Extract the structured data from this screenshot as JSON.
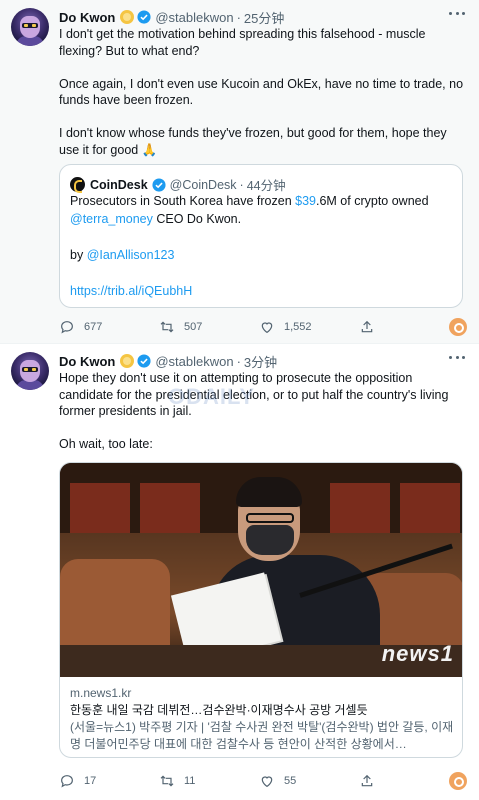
{
  "tweets": [
    {
      "author": "Do Kwon",
      "handle": "@stablekwon",
      "time": "25分钟",
      "text": "I don't get the motivation behind spreading this falsehood - muscle flexing? But to what end?\n\nOnce again, I don't even use Kucoin and OkEx, have no time to trade, no funds have been frozen.\n\nI don't know whose funds they've frozen, but good for them, hope they use it for good 🙏",
      "quote": {
        "author": "CoinDesk",
        "handle": "@CoinDesk",
        "time": "44分钟",
        "line1_pre": "Prosecutors in South Korea have frozen ",
        "line1_link": "$39",
        "line1_post": ".6M of crypto owned",
        "line2_link": "@terra_money",
        "line2_post": " CEO Do Kwon.",
        "by_pre": "by ",
        "by_link": "@IanAllison123",
        "url": "https://trib.al/iQEubhH"
      },
      "stats": {
        "replies": "677",
        "retweets": "507",
        "likes": "1,552"
      }
    },
    {
      "author": "Do Kwon",
      "handle": "@stablekwon",
      "time": "3分钟",
      "text": "Hope they don't use it on attempting to prosecute the opposition candidate for the presidential election, or to put half the country's living former presidents in jail.\n\nOh wait, too late:",
      "card": {
        "domain": "m.news1.kr",
        "title": "한동훈 내일 국감 데뷔전…검수완박·이재명수사 공방 거셀듯",
        "description": "(서울=뉴스1) 박주평 기자 | '검찰 수사권 완전 박탈'(검수완박) 법안 갈등, 이재명 더불어민주당 대표에 대한 검찰수사 등 현안이 산적한 상황에서…",
        "image_brand": "news1"
      },
      "stats": {
        "replies": "17",
        "retweets": "11",
        "likes": "55"
      }
    }
  ],
  "watermark": "ODAILY",
  "colors": {
    "link": "#1d9bf0",
    "muted": "#536471",
    "text": "#0f1419",
    "accent": "#f0a35e"
  },
  "icons": [
    "reply-icon",
    "retweet-icon",
    "like-icon",
    "share-icon",
    "more-icon",
    "verified-icon",
    "gold-badge-icon"
  ]
}
